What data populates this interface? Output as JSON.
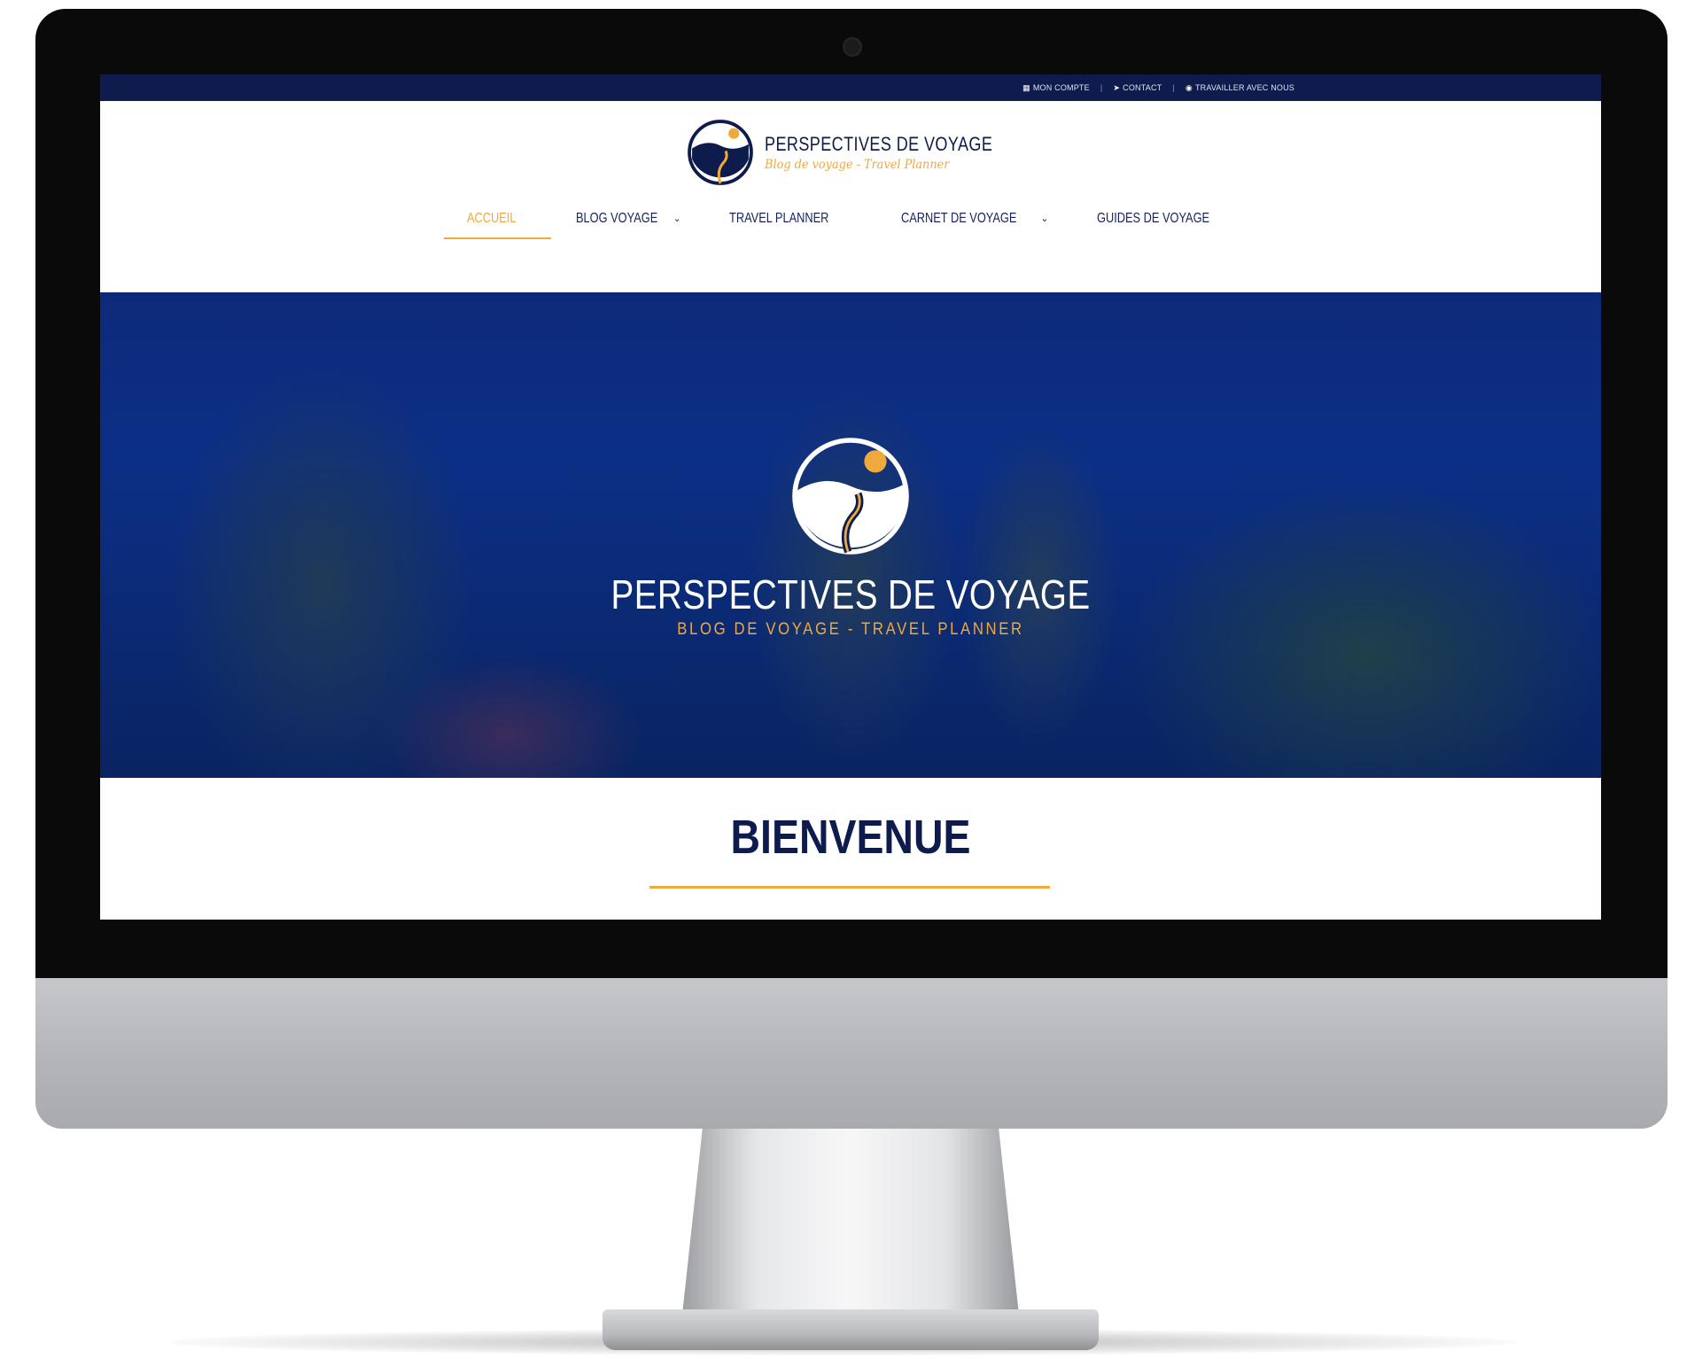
{
  "colors": {
    "navy": "#0e1b4d",
    "accent": "#f0a93c",
    "hero_overlay": "#0c2f86"
  },
  "topbar": {
    "links": [
      {
        "icon": "book-icon",
        "label": "MON COMPTE"
      },
      {
        "icon": "paper-plane-icon",
        "label": "CONTACT"
      },
      {
        "icon": "globe-icon",
        "label": "TRAVAILLER AVEC NOUS"
      }
    ]
  },
  "header": {
    "brand_name": "PERSPECTIVES DE VOYAGE",
    "brand_tagline": "Blog de voyage - Travel Planner",
    "logo_icon": "road-sun-circle-logo"
  },
  "nav": {
    "items": [
      {
        "label": "ACCUEIL",
        "active": true
      },
      {
        "label": "BLOG VOYAGE",
        "dropdown": true
      },
      {
        "label": "TRAVEL PLANNER"
      },
      {
        "label": "CARNET DE VOYAGE",
        "dropdown": true
      },
      {
        "label": "GUIDES DE VOYAGE"
      }
    ]
  },
  "hero": {
    "title": "PERSPECTIVES DE VOYAGE",
    "subtitle": "BLOG DE VOYAGE - TRAVEL PLANNER"
  },
  "welcome": {
    "title": "BIENVENUE"
  }
}
